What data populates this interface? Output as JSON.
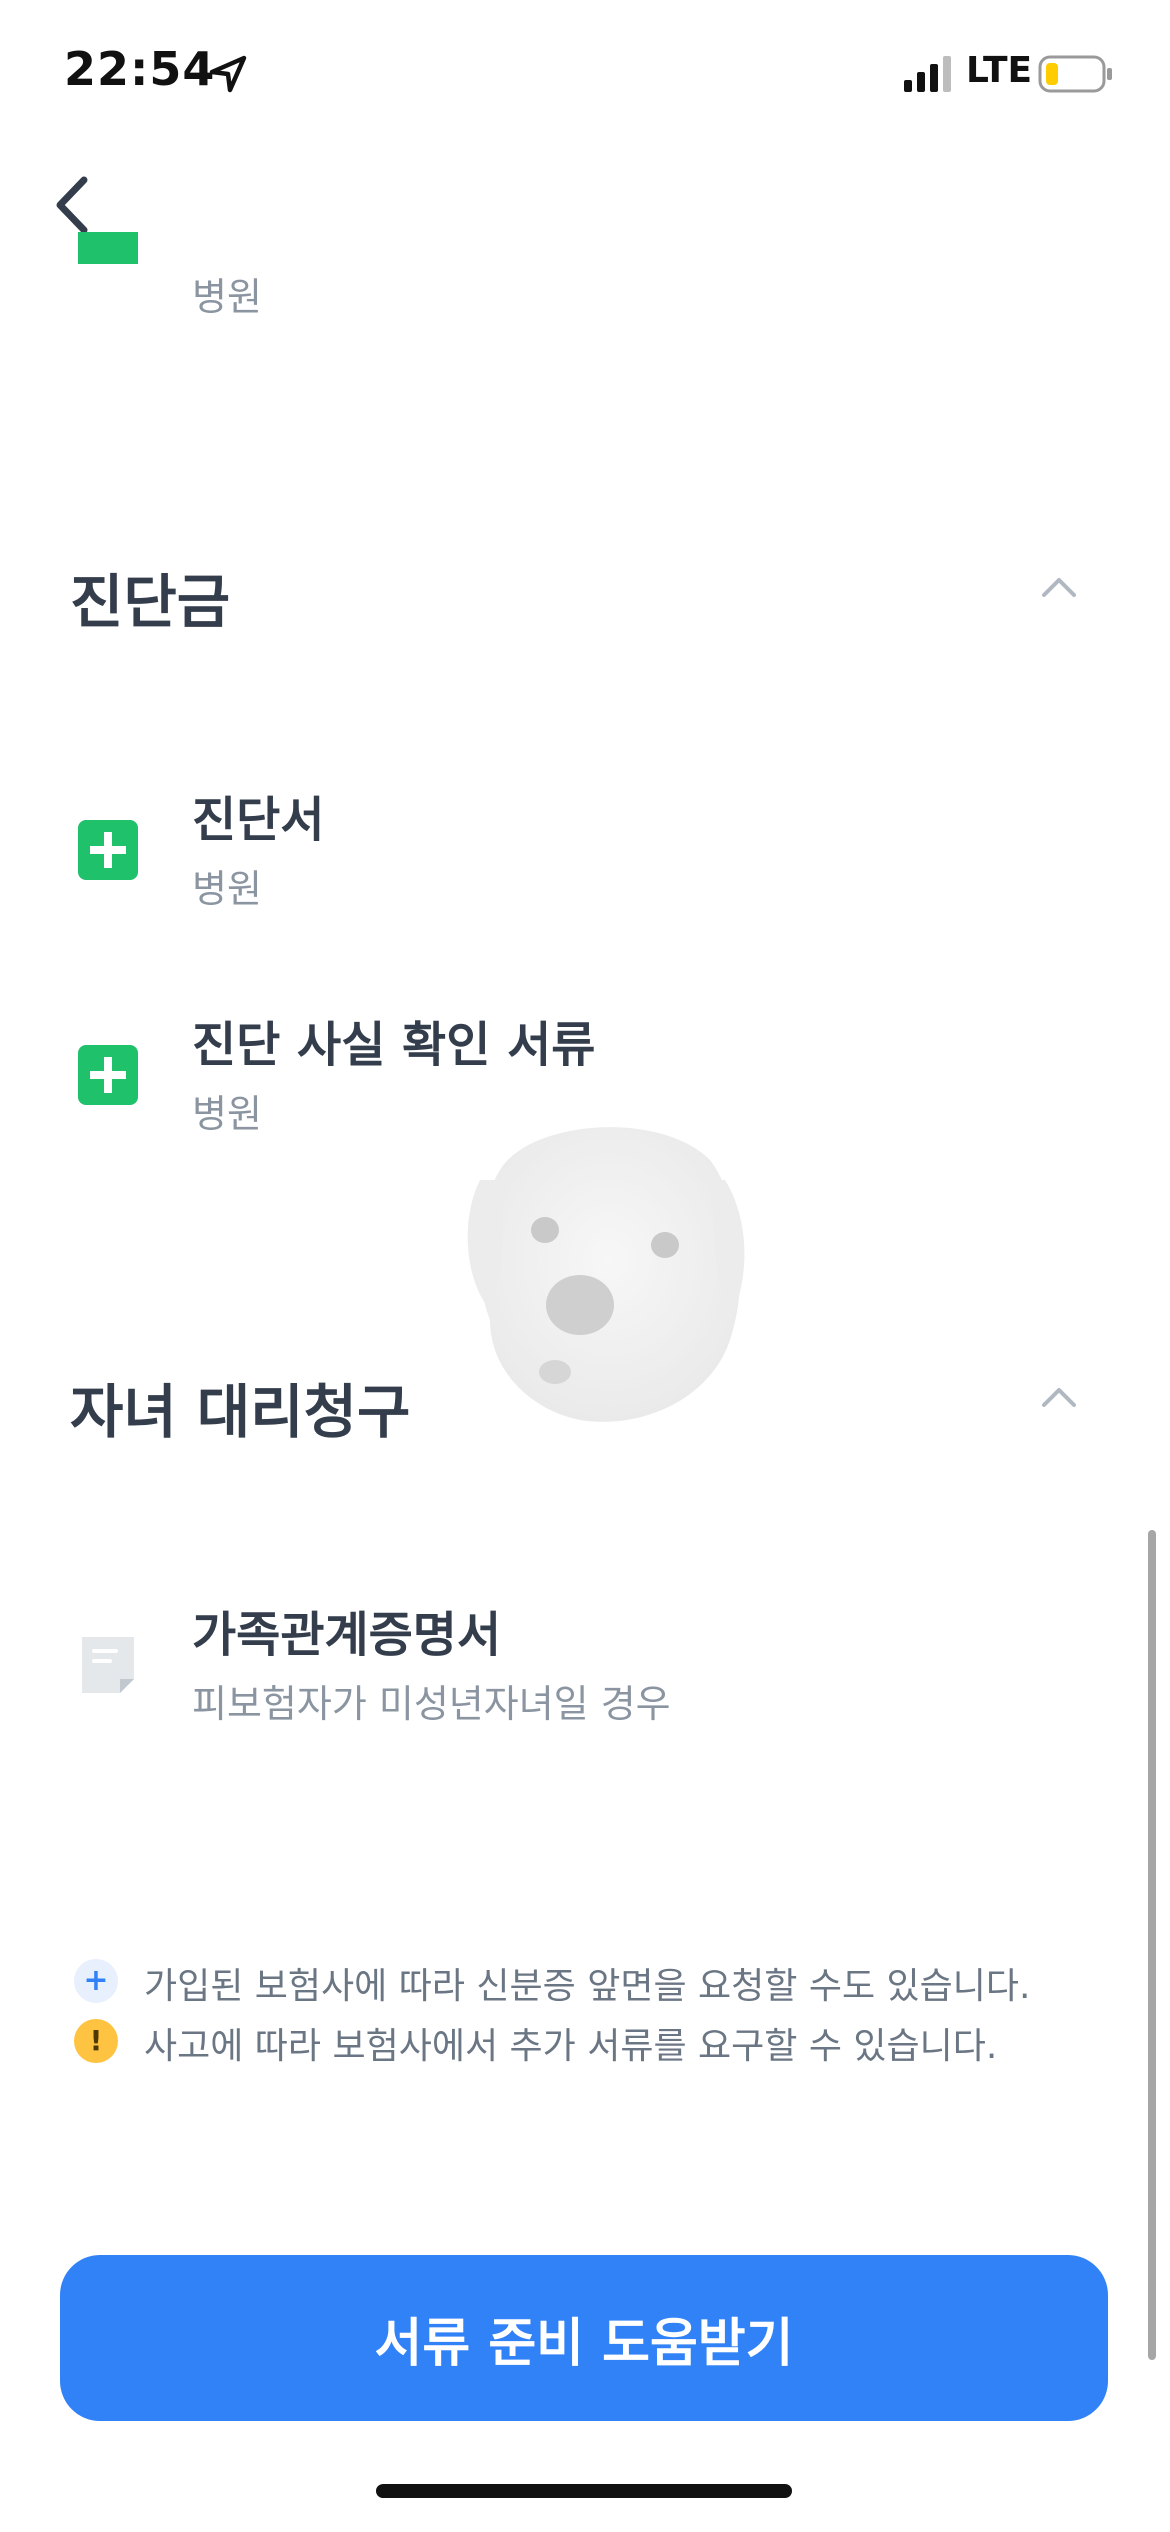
{
  "status_bar": {
    "time": "22:54",
    "network": "LTE",
    "battery_color": "#ffcc00"
  },
  "nav": {
    "back_icon": "chevron-left-icon"
  },
  "top_partial_item": {
    "sub": "병원"
  },
  "sections": [
    {
      "title": "진단금",
      "expanded": true,
      "items": [
        {
          "title": "진단서",
          "sub": "병원",
          "icon": "plus-square-icon"
        },
        {
          "title": "진단 사실 확인 서류",
          "sub": "병원",
          "icon": "plus-square-icon"
        }
      ]
    },
    {
      "title": "자녀 대리청구",
      "expanded": true,
      "items": [
        {
          "title": "가족관계증명서",
          "sub": "피보험자가 미성년자녀일 경우",
          "icon": "document-icon"
        }
      ]
    }
  ],
  "notes": [
    {
      "icon": "plus-circle-icon",
      "text": "가입된 보험사에 따라 신분증 앞면을 요청할 수도 있습니다."
    },
    {
      "icon": "exclamation-circle-icon",
      "text": "사고에 따라 보험사에서 추가 서류를 요구할 수 있습니다."
    }
  ],
  "cta": {
    "label": "서류 준비 도움받기",
    "color": "#3182f6"
  },
  "colors": {
    "accent_green": "#1fc16b",
    "text_primary": "#333d4b",
    "text_secondary": "#8b95a1"
  }
}
